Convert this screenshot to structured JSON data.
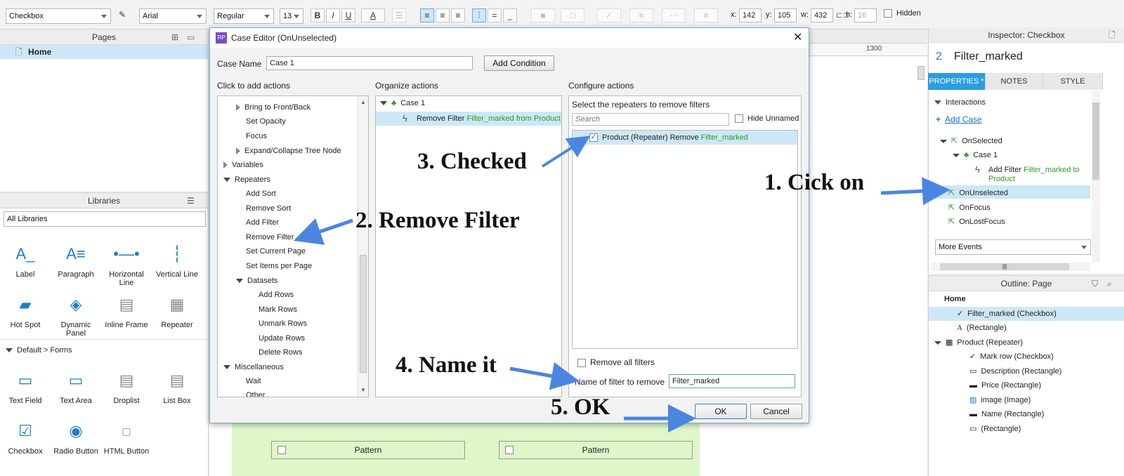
{
  "toolbar": {
    "widget_type": "Checkbox",
    "font_family": "Arial",
    "font_style": "Regular",
    "font_size": "13",
    "x_label": "x:",
    "x_value": "142",
    "y_label": "y:",
    "y_value": "105",
    "w_label": "w:",
    "w_value": "432",
    "h_label": "h:",
    "h_value": "16",
    "hidden_label": "Hidden",
    "bold": "B",
    "italic": "I",
    "underline": "U",
    "font_color": "A"
  },
  "pages_panel": {
    "title": "Pages",
    "home": "Home"
  },
  "libraries_panel": {
    "title": "Libraries",
    "dropdown": "All Libraries",
    "items": [
      "Label",
      "Paragraph",
      "Horizontal Line",
      "Vertical Line",
      "Hot Spot",
      "Dynamic Panel",
      "Inline Frame",
      "Repeater"
    ],
    "forms_header": "Default > Forms",
    "form_items": [
      "Text Field",
      "Text Area",
      "Droplist",
      "List Box",
      "Checkbox",
      "Radio Button",
      "HTML Button"
    ]
  },
  "ruler": {
    "tick": "1300"
  },
  "canvas": {
    "pattern_1": "Pattern",
    "pattern_2": "Pattern"
  },
  "dialog": {
    "title": "Case Editor (OnUnselected)",
    "case_name_label": "Case Name",
    "case_name_value": "Case 1",
    "add_condition": "Add Condition",
    "col1_header": "Click to add actions",
    "col2_header": "Organize actions",
    "col3_header": "Configure actions",
    "actions": [
      "Bring to Front/Back",
      "Set Opacity",
      "Focus",
      "Expand/Collapse Tree Node",
      "Variables",
      "Repeaters",
      "Add Sort",
      "Remove Sort",
      "Add Filter",
      "Remove Filter",
      "Set Current Page",
      "Set Items per Page",
      "Datasets",
      "Add Rows",
      "Mark Rows",
      "Unmark Rows",
      "Update Rows",
      "Delete Rows",
      "Miscellaneous",
      "Wait",
      "Other"
    ],
    "organize": {
      "case": "Case 1",
      "action_prefix": "Remove Filter",
      "action_name": "Filter_marked",
      "action_suffix": "from Product"
    },
    "configure": {
      "header": "Select the repeaters to remove filters",
      "search_placeholder": "Search",
      "hide_unnamed": "Hide Unnamed",
      "repeater_label": "Product (Repeater) Remove",
      "repeater_filter": "Filter_marked",
      "remove_all": "Remove all filters",
      "filter_name_label": "Name of filter to remove",
      "filter_name_value": "Filter_marked"
    },
    "ok": "OK",
    "cancel": "Cancel"
  },
  "annotations": {
    "a1": "1. Cick on",
    "a2": "2. Remove Filter",
    "a3": "3. Checked",
    "a4": "4. Name it",
    "a5": "5. OK"
  },
  "inspector": {
    "title": "Inspector: Checkbox",
    "widget_number": "2",
    "widget_name": "Filter_marked",
    "tabs": [
      "PROPERTIES *",
      "NOTES",
      "STYLE"
    ],
    "interactions": "Interactions",
    "add_case": "Add Case",
    "events": {
      "on_selected": "OnSelected",
      "case1": "Case 1",
      "add_filter_prefix": "Add Filter",
      "add_filter_name": "Filter_marked to",
      "add_filter_target": "Product",
      "on_unselected": "OnUnselected",
      "on_focus": "OnFocus",
      "on_lost_focus": "OnLostFocus"
    },
    "more_events": "More Events"
  },
  "outline": {
    "title": "Outline: Page",
    "items": [
      "Home",
      "Filter_marked (Checkbox)",
      "(Rectangle)",
      "Product (Repeater)",
      "Mark row (Checkbox)",
      "Description (Rectangle)",
      "Price (Rectangle)",
      "image (Image)",
      "Name (Rectangle)",
      "(Rectangle)"
    ]
  },
  "colors": {
    "accent": "#2b9ee0",
    "selection": "#cce8f6",
    "green_text": "#2a9a2a",
    "arrow": "#4a86e0",
    "canvas_green": "#dff6c9"
  }
}
